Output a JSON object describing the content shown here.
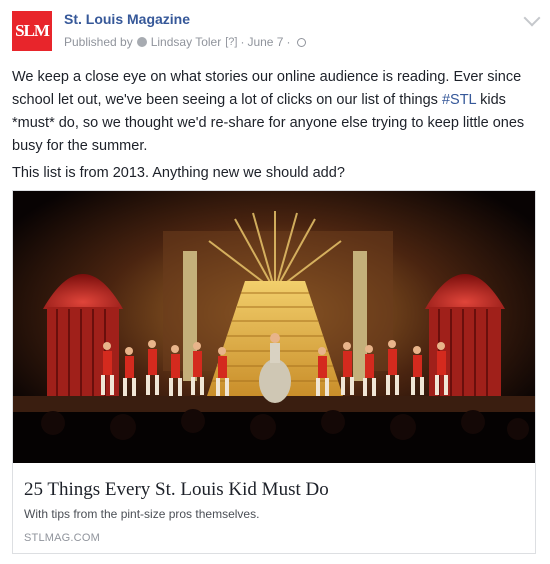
{
  "page": {
    "logo_text": "SLM",
    "name": "St. Louis Magazine",
    "published_by": "Published by",
    "author": "Lindsay Toler",
    "help": "[?]",
    "date": "June 7",
    "separator": "·"
  },
  "post": {
    "p1_part1": "We keep a close eye on what stories our online audience is reading. Ever since school let out, we've been seeing a lot of clicks on our list of things ",
    "hashtag": "#STL",
    "p1_part2": " kids *must* do, so we thought we'd re-share for anyone else trying to keep little ones busy for the summer.",
    "p2": "This list is from 2013. Anything new we should add?"
  },
  "link_card": {
    "title": "25 Things Every St. Louis Kid Must Do",
    "description": "With tips from the pint-size pros themselves.",
    "domain": "STLMAG.COM"
  },
  "colors": {
    "brand_red": "#e8252b",
    "link_blue": "#365899"
  }
}
